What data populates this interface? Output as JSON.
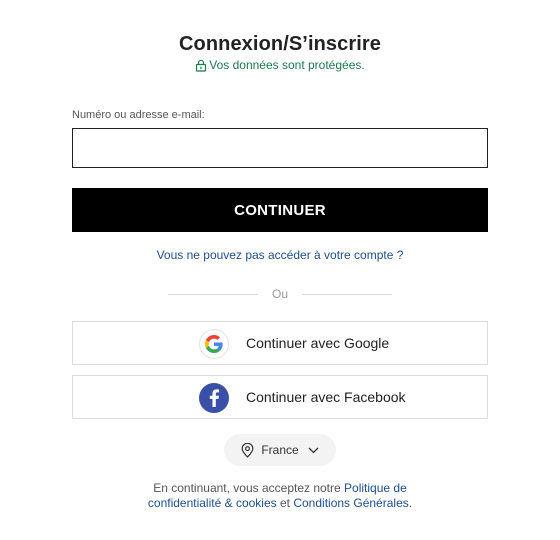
{
  "header": {
    "title": "Connexion/S’inscrire",
    "secure_text": "Vos données sont protégées.",
    "lock_icon": "lock-icon"
  },
  "form": {
    "field_label": "Numéro ou adresse e-mail:",
    "field_value": "",
    "field_placeholder": "",
    "continue_label": "CONTINUER",
    "forgot_link": "Vous ne pouvez pas accéder à votre compte ?",
    "divider_text": "Ou"
  },
  "social": {
    "google": {
      "label": "Continuer avec Google",
      "icon": "google-icon"
    },
    "facebook": {
      "label": "Continuer avec Facebook",
      "icon": "facebook-icon"
    }
  },
  "country": {
    "label": "France",
    "icon": "location-pin-icon",
    "chevron": "chevron-down-icon"
  },
  "legal": {
    "prefix": "En continuant, vous acceptez notre",
    "privacy_link": "Politique de confidentialité & cookies",
    "conjunction": "et",
    "terms_link": "Conditions Générales",
    "suffix": "."
  },
  "colors": {
    "secure_green": "#1b7a4b",
    "link_blue": "#1e4e8c",
    "button_black": "#000000",
    "facebook_blue": "#3a4fa8"
  }
}
